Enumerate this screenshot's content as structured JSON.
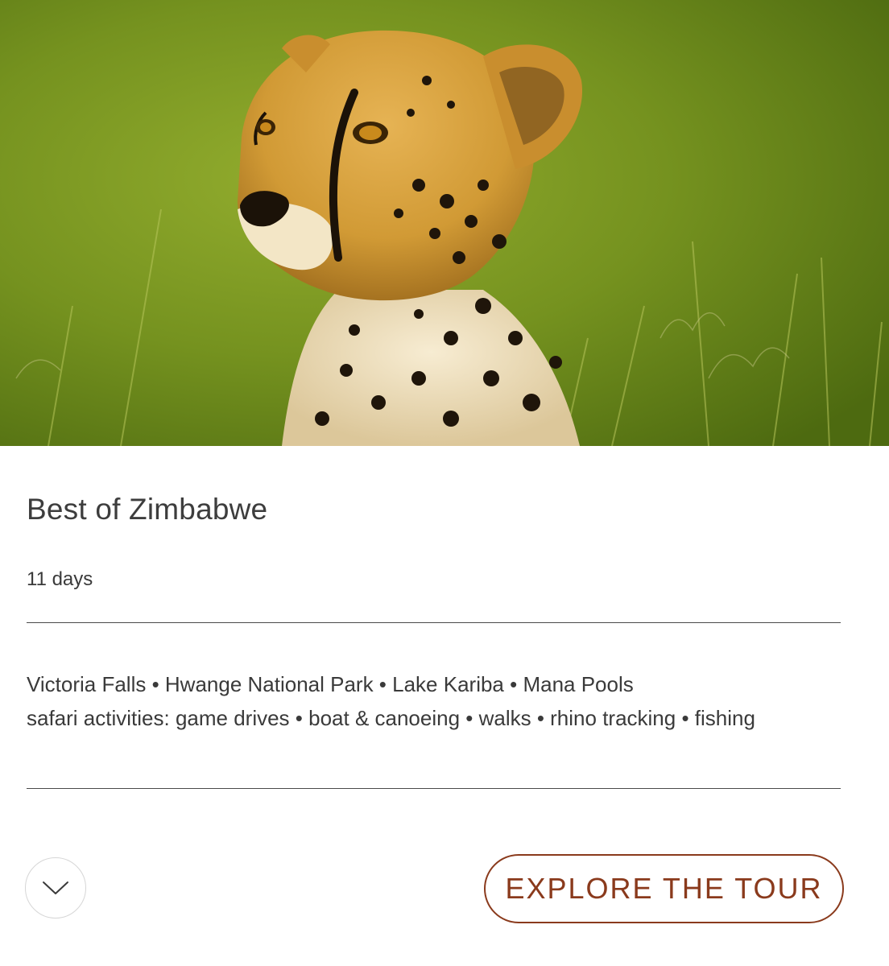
{
  "hero": {
    "image_subject": "cheetah in tall green grass"
  },
  "tour": {
    "title": "Best of Zimbabwe",
    "duration": "11 days",
    "places": "Victoria Falls • Hwange National Park • Lake Kariba • Mana Pools",
    "activities": "safari activities: game drives • boat & canoeing • walks • rhino tracking • fishing"
  },
  "actions": {
    "expand_icon": "chevron-down-icon",
    "explore_label": "EXPLORE THE TOUR"
  },
  "colors": {
    "accent": "#8a3a1c",
    "text": "#3a3a3a",
    "divider": "#4a4a4a"
  }
}
